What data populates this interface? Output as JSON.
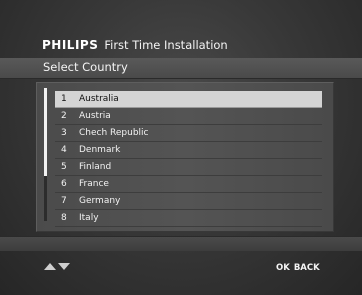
{
  "header": {
    "brand": "PHILIPS",
    "title": "First Time Installation"
  },
  "subtitle": "Select Country",
  "scroll": {
    "position_fraction": 0.0,
    "visible_fraction": 0.66
  },
  "countries": [
    {
      "num": "1",
      "name": "Australia",
      "selected": true
    },
    {
      "num": "2",
      "name": "Austria",
      "selected": false
    },
    {
      "num": "3",
      "name": "Chech Republic",
      "selected": false
    },
    {
      "num": "4",
      "name": "Denmark",
      "selected": false
    },
    {
      "num": "5",
      "name": "Finland",
      "selected": false
    },
    {
      "num": "6",
      "name": "France",
      "selected": false
    },
    {
      "num": "7",
      "name": "Germany",
      "selected": false
    },
    {
      "num": "8",
      "name": "Italy",
      "selected": false
    }
  ],
  "footer": {
    "navigate_icon": "up-down-arrows-icon",
    "ok_label": "OK",
    "back_label": "BACK"
  },
  "colors": {
    "selected_row": "#d4d4d4",
    "background": "#2e2e2e"
  }
}
